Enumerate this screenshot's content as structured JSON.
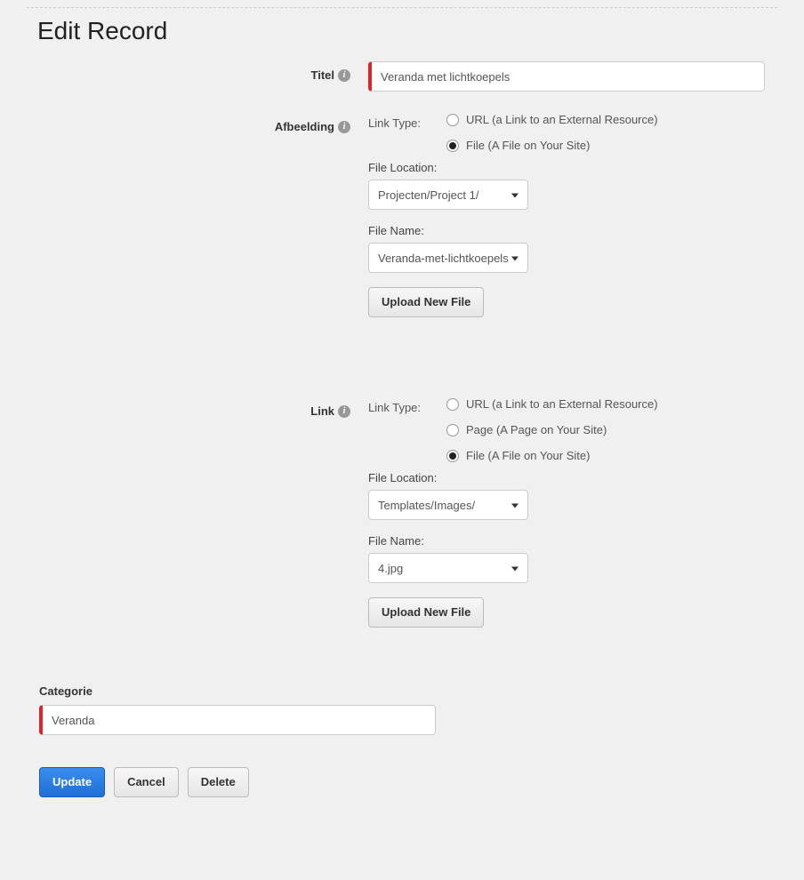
{
  "page_title": "Edit Record",
  "fields": {
    "titel": {
      "label": "Titel",
      "value": "Veranda met lichtkoepels"
    },
    "afbeelding": {
      "label": "Afbeelding",
      "link_type_label": "Link Type:",
      "options": {
        "url": "URL (a Link to an External Resource)",
        "file": "File (A File on Your Site)"
      },
      "selected": "file",
      "file_location_label": "File Location:",
      "file_location_value": "Projecten/Project 1/",
      "file_name_label": "File Name:",
      "file_name_value": "Veranda-met-lichtkoepels",
      "upload_button": "Upload New File"
    },
    "link": {
      "label": "Link",
      "link_type_label": "Link Type:",
      "options": {
        "url": "URL (a Link to an External Resource)",
        "page": "Page (A Page on Your Site)",
        "file": "File (A File on Your Site)"
      },
      "selected": "file",
      "file_location_label": "File Location:",
      "file_location_value": "Templates/Images/",
      "file_name_label": "File Name:",
      "file_name_value": "4.jpg",
      "upload_button": "Upload New File"
    },
    "categorie": {
      "label": "Categorie",
      "value": "Veranda"
    }
  },
  "actions": {
    "update": "Update",
    "cancel": "Cancel",
    "delete": "Delete"
  }
}
